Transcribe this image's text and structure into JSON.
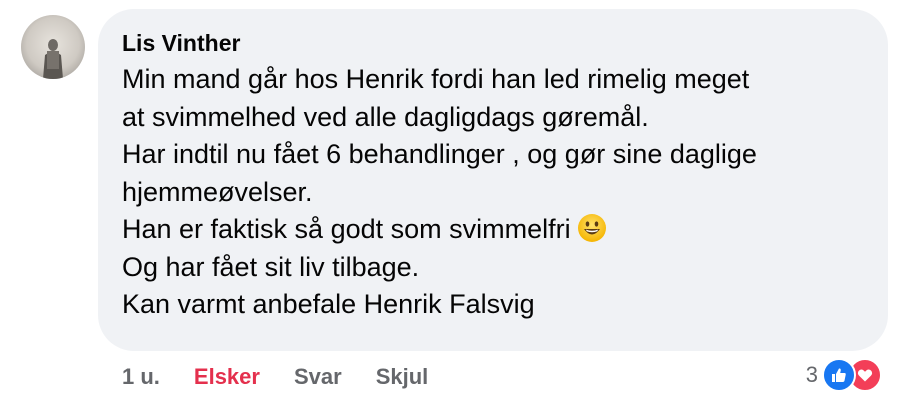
{
  "comment": {
    "author": "Lis Vinther",
    "lines": [
      "Min mand går hos Henrik fordi han led rimelig meget",
      "at svimmelhed ved alle dagligdags gøremål.",
      "Har indtil nu fået 6 behandlinger , og gør sine daglige",
      "hjemmeøvelser.",
      "Han er faktisk så godt som svimmelfri",
      "Og har fået sit liv tilbage.",
      "Kan varmt anbefale Henrik Falsvig"
    ],
    "emoji": "grinning-face"
  },
  "actions": {
    "time": "1 u.",
    "love_label": "Elsker",
    "reply_label": "Svar",
    "hide_label": "Skjul"
  },
  "reactions": {
    "count": "3",
    "types": [
      "like",
      "love"
    ]
  },
  "colors": {
    "bubble": "#f0f2f5",
    "love_active": "#e4304d",
    "meta_text": "#65676b",
    "like_blue": "#1877f2",
    "heart_red": "#f33e58"
  }
}
